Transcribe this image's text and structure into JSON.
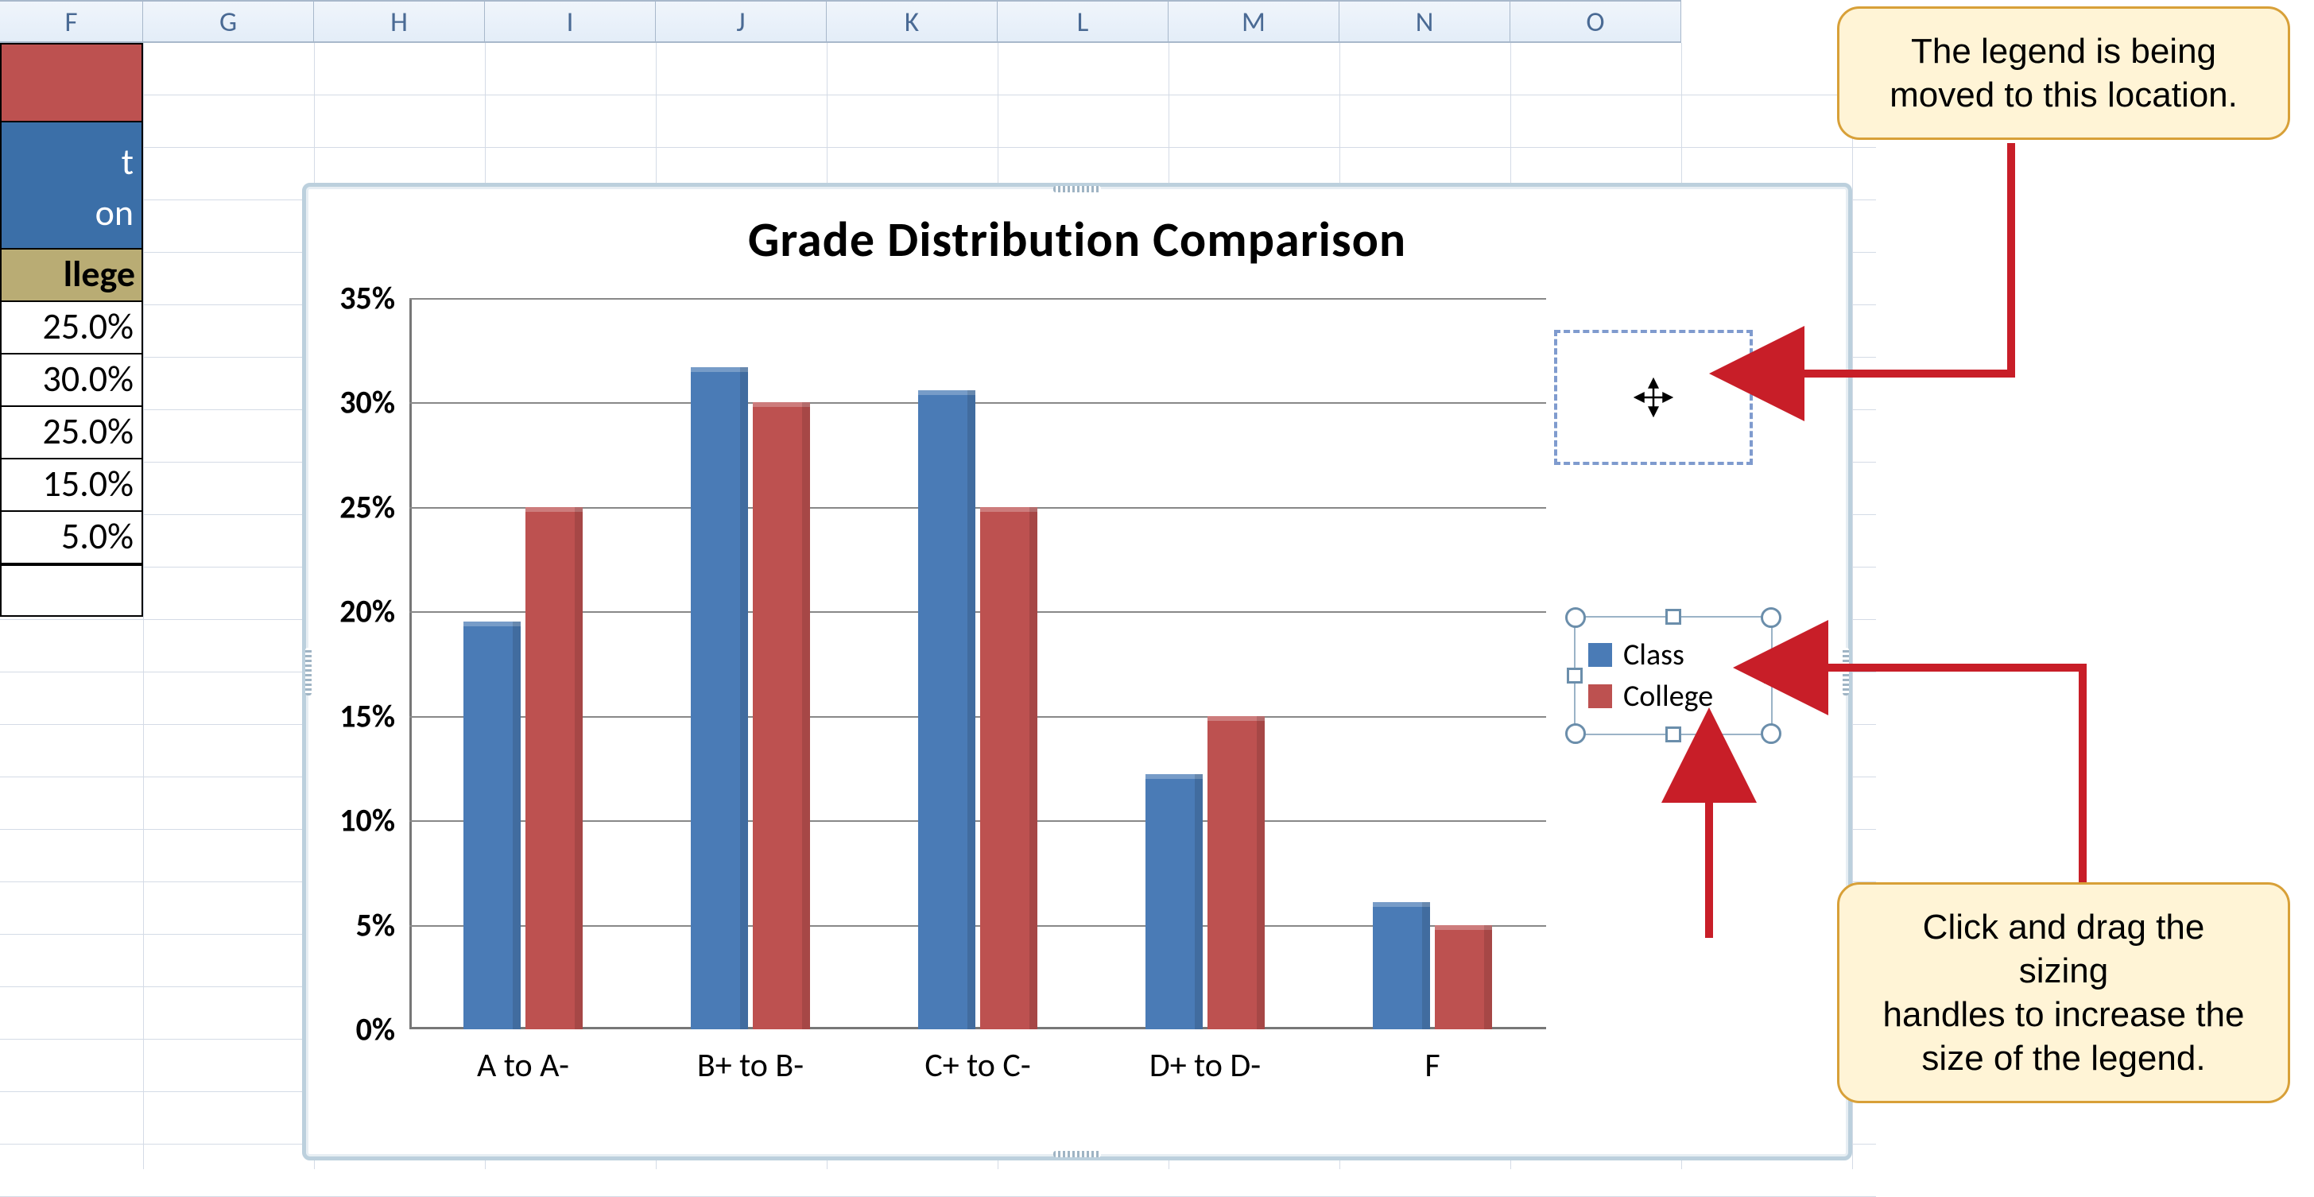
{
  "columns": [
    "F",
    "G",
    "H",
    "I",
    "J",
    "K",
    "L",
    "M",
    "N",
    "O"
  ],
  "left_panel": {
    "blue_line1": "t",
    "blue_line2": "on",
    "tan_label": "llege",
    "pcts": [
      "25.0%",
      "30.0%",
      "25.0%",
      "15.0%",
      "5.0%"
    ]
  },
  "callouts": {
    "top": "The legend is being\nmoved to this location.",
    "bottom": "Click and drag the sizing\nhandles to increase the\nsize of the legend."
  },
  "legend": {
    "items": [
      "Class",
      "College"
    ]
  },
  "chart_data": {
    "type": "bar",
    "title": "Grade Distribution  Comparison",
    "xlabel": "",
    "ylabel": "",
    "ylim": [
      0,
      35
    ],
    "yticks": [
      0,
      5,
      10,
      15,
      20,
      25,
      30,
      35
    ],
    "ytick_labels": [
      "0%",
      "5%",
      "10%",
      "15%",
      "20%",
      "25%",
      "30%",
      "35%"
    ],
    "categories": [
      "A to A-",
      "B+ to B-",
      "C+ to C-",
      "D+ to D-",
      "F"
    ],
    "series": [
      {
        "name": "Class",
        "values": [
          19.5,
          31.7,
          30.6,
          12.2,
          6.1
        ]
      },
      {
        "name": "College",
        "values": [
          25.0,
          30.0,
          25.0,
          15.0,
          5.0
        ]
      }
    ]
  }
}
